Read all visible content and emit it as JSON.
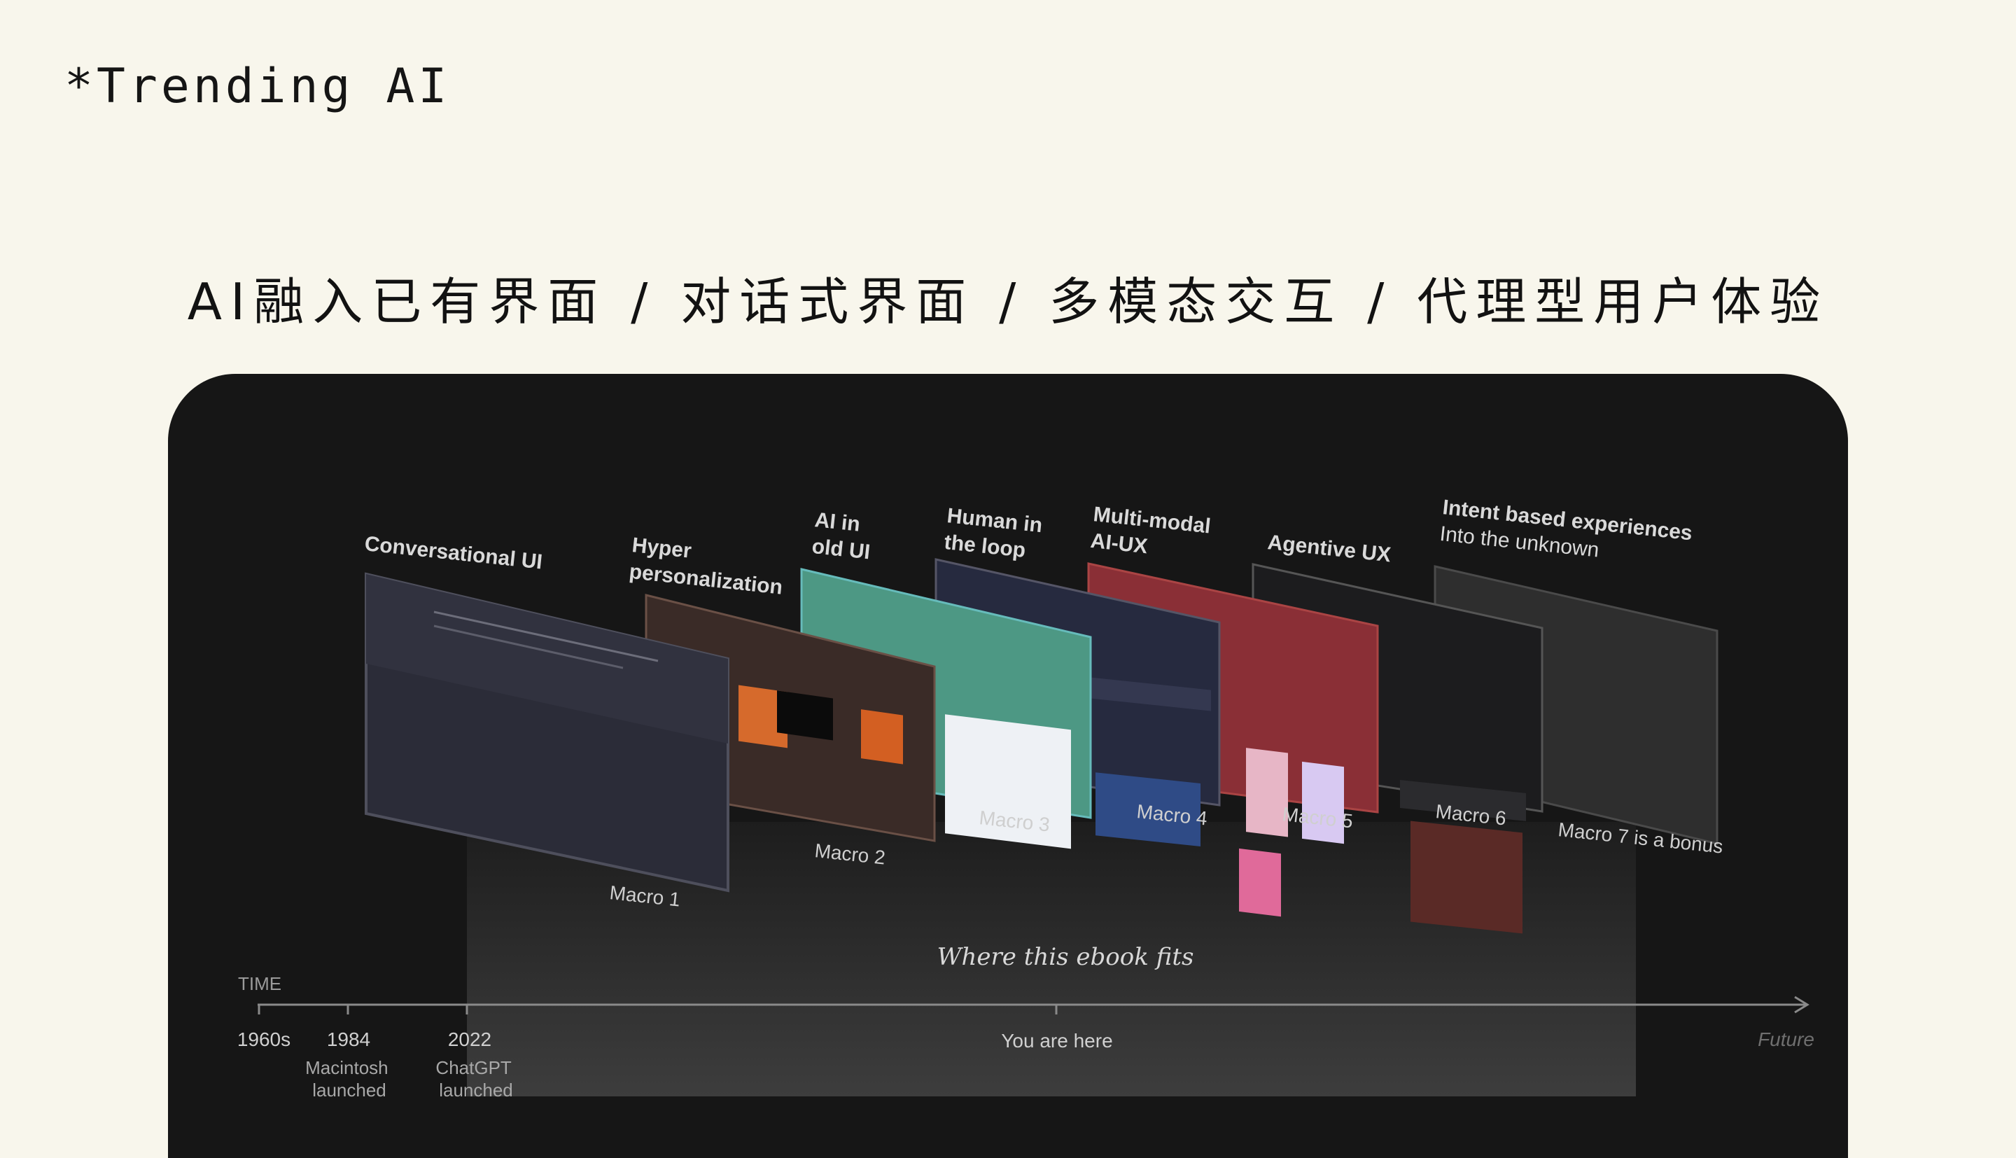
{
  "brand": "*Trending AI",
  "headline": "AI融入已有界面  /  对话式界面  /  多模态交互  /  代理型用户体验",
  "colors": {
    "page_bg": "#f8f6ec",
    "panel_bg": "#161616",
    "macro1": "#2b2c38",
    "macro2": "#3a2b27",
    "macro3": "#4d9884",
    "macro4": "#262a3f",
    "macro5": "#8a2f36",
    "macro6": "#1c1c1e",
    "macro7": "#2e2e2e"
  },
  "macros": [
    {
      "title": [
        "Conversational UI"
      ],
      "label": "Macro 1"
    },
    {
      "title": [
        "Hyper",
        "personalization"
      ],
      "label": "Macro 2"
    },
    {
      "title": [
        "AI in",
        "old UI"
      ],
      "label": "Macro 3"
    },
    {
      "title": [
        "Human in",
        "the loop"
      ],
      "label": "Macro 4"
    },
    {
      "title": [
        "Multi-modal",
        "AI-UX"
      ],
      "label": "Macro 5"
    },
    {
      "title": [
        "Agentive UX"
      ],
      "label": "Macro 6"
    },
    {
      "title": [
        "Intent based experiences",
        "Into the unknown"
      ],
      "label": "Macro 7 is a bonus"
    }
  ],
  "ebook_caption": "Where this ebook fits",
  "timeline": {
    "axis_label": "TIME",
    "ticks": [
      {
        "year": "1960s",
        "note": []
      },
      {
        "year": "1984",
        "note": [
          "Macintosh",
          "launched"
        ]
      },
      {
        "year": "2022",
        "note": [
          "ChatGPT",
          "launched"
        ]
      }
    ],
    "you_are_here": "You are here",
    "future": "Future"
  }
}
